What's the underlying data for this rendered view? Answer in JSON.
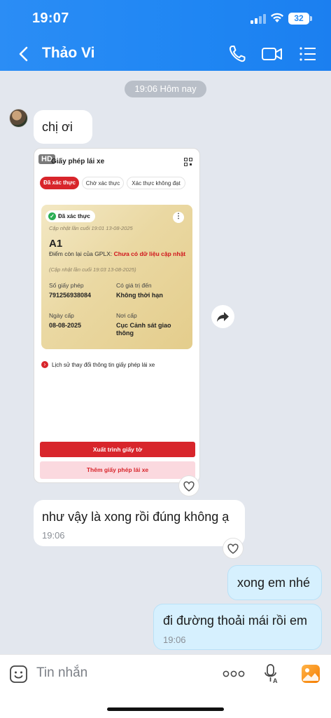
{
  "status_bar": {
    "time": "19:07",
    "battery": "32"
  },
  "header": {
    "contact_name": "Thảo Vi"
  },
  "date_divider": "19:06 Hôm nay",
  "messages": {
    "m1": {
      "text": "chị ơi"
    },
    "m3": {
      "text": "như vậy là xong rồi đúng không ạ",
      "time": "19:06"
    },
    "m4": {
      "text": "xong em nhé"
    },
    "m5": {
      "text": "đi đường thoải mái rồi em",
      "time": "19:06"
    }
  },
  "image_card": {
    "hd_badge": "HD",
    "title": "Giấy phép lái xe",
    "tabs": [
      "Đã xác thực",
      "Chờ xác thực",
      "Xác thực không đạt"
    ],
    "verified_label": "Đã xác thực",
    "updated_1": "Cập nhật lần cuối 19:01 13-08-2025",
    "license_class": "A1",
    "points_label": "Điểm còn lại của GPLX:",
    "points_value": "Chưa có dữ liệu cập nhật",
    "updated_2": "(Cập nhật lần cuối 19:03 13-08-2025)",
    "number_label": "Số giấy phép",
    "number_value": "791256938084",
    "valid_label": "Có giá trị đến",
    "valid_value": "Không thời hạn",
    "issue_date_label": "Ngày cấp",
    "issue_date_value": "08-08-2025",
    "issuer_label": "Nơi cấp",
    "issuer_value": "Cục Cảnh sát giao thông",
    "history_link": "Lịch sử thay đổi thông tin giấy phép lái xe",
    "present_button": "Xuất trình giấy tờ",
    "add_button": "Thêm giấy phép lái xe"
  },
  "composer": {
    "placeholder": "Tin nhắn"
  },
  "colors": {
    "header_blue": "#2b8df5",
    "accent_red": "#d8252b",
    "outgoing_bubble": "#d6f0fe"
  }
}
